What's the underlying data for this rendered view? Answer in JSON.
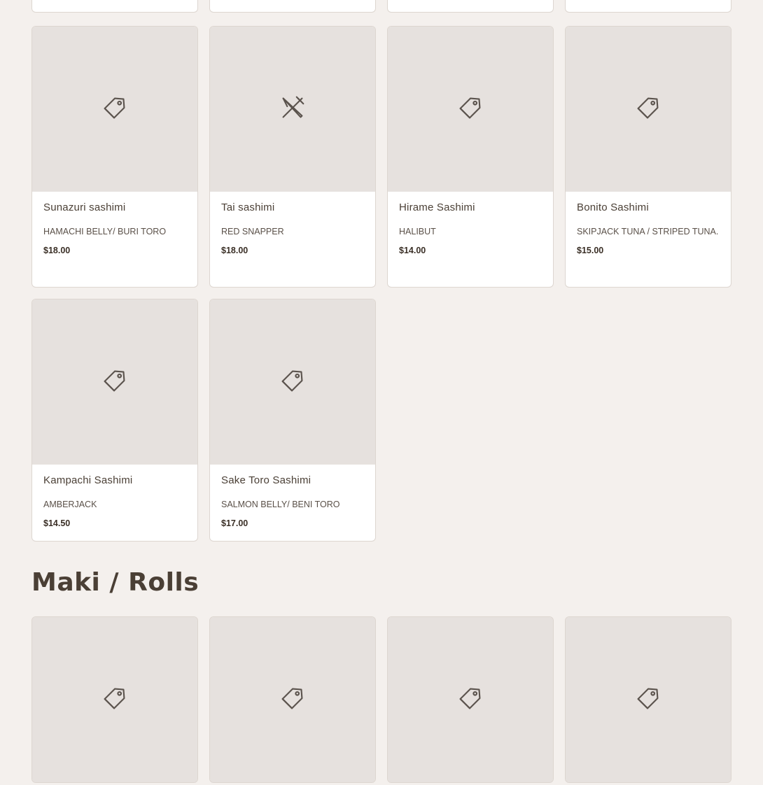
{
  "sashimi": [
    {
      "name": "Sunazuri sashimi",
      "desc": "HAMACHI BELLY/ BURI TORO",
      "price": "$18.00",
      "icon": "tag-icon"
    },
    {
      "name": "Tai sashimi",
      "desc": "RED SNAPPER",
      "price": "$18.00",
      "icon": "utensils-icon"
    },
    {
      "name": "Hirame Sashimi",
      "desc": "HALIBUT",
      "price": "$14.00",
      "icon": "tag-icon"
    },
    {
      "name": "Bonito Sashimi",
      "desc": "SKIPJACK TUNA / STRIPED TUNA.",
      "price": "$15.00",
      "icon": "tag-icon"
    },
    {
      "name": "Kampachi Sashimi",
      "desc": "AMBERJACK",
      "price": "$14.50",
      "icon": "tag-icon"
    },
    {
      "name": "Sake Toro Sashimi",
      "desc": "SALMON BELLY/ BENI TORO",
      "price": "$17.00",
      "icon": "tag-icon"
    }
  ],
  "section": {
    "title": "Maki / Rolls"
  },
  "colors": {
    "background": "#f4f0ed",
    "placeholder": "#e6e1de",
    "text": "#4a3f35"
  }
}
